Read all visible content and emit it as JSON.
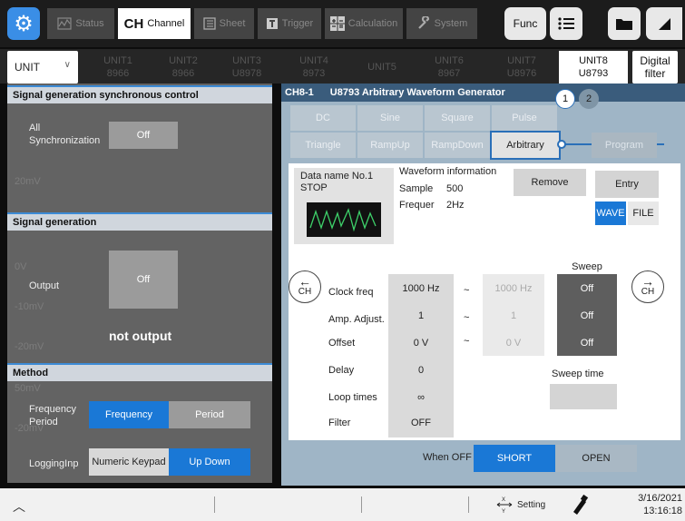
{
  "toolbar": {
    "tabs": [
      {
        "label": "Status",
        "icon": "status-icon"
      },
      {
        "label_big": "CH",
        "label_small": "Channel"
      },
      {
        "label": "Sheet",
        "icon": "sheet-icon"
      },
      {
        "label": "Trigger",
        "icon": "trigger-icon"
      },
      {
        "label": "Calculation",
        "icon": "calculation-icon"
      },
      {
        "label": "System",
        "icon": "wrench-icon"
      }
    ],
    "func_label": "Func"
  },
  "unitbar": {
    "selector": "UNIT",
    "units": [
      {
        "name": "UNIT1",
        "model": "8966"
      },
      {
        "name": "UNIT2",
        "model": "8966"
      },
      {
        "name": "UNIT3",
        "model": "U8978"
      },
      {
        "name": "UNIT4",
        "model": "8973"
      },
      {
        "name": "UNIT5",
        "model": ""
      },
      {
        "name": "UNIT6",
        "model": "8967"
      },
      {
        "name": "UNIT7",
        "model": "U8976"
      },
      {
        "name": "UNIT8",
        "model": "U8793"
      }
    ],
    "digital_filter": [
      "Digital",
      "filter"
    ]
  },
  "left": {
    "sync_title": "Signal generation synchronous control",
    "all_sync_label": [
      "All",
      "Synchronization"
    ],
    "all_sync_value": "Off",
    "gen_title": "Signal generation",
    "output_label": "Output",
    "output_value": "Off",
    "not_output": "not output",
    "method_title": "Method",
    "freq_period_label": [
      "Frequency",
      "Period"
    ],
    "frequency_btn": "Frequency",
    "period_btn": "Period",
    "logging_label": "LoggingInp",
    "numeric_btn": "Numeric Keypad",
    "updown_btn": "Up Down",
    "ghost_text": [
      "20mV",
      "0V",
      "-10mV",
      "-20mV",
      "50mV",
      "-20mV"
    ]
  },
  "dialog": {
    "channel": "CH8-1",
    "title": "U8793 Arbitrary Waveform Generator",
    "pages": [
      "1",
      "2"
    ],
    "wave_buttons_row1": [
      "DC",
      "Sine",
      "Square",
      "Pulse"
    ],
    "wave_buttons_row2": [
      "Triangle",
      "RampUp",
      "RampDown",
      "Arbitrary"
    ],
    "program_btn": "Program",
    "data_name": "Data name",
    "data_no": "No.1",
    "data_state": "STOP",
    "waveform_info": "Waveform information",
    "sample_label": "Sample",
    "sample_value": "500",
    "freq_label": "Frequer",
    "freq_value": "2Hz",
    "remove_btn": "Remove",
    "entry_btn": "Entry",
    "wave_toggle": "WAVE",
    "file_toggle": "FILE",
    "sweep_label": "Sweep",
    "sweep_time_label": "Sweep time",
    "nav_prev": [
      "←",
      "CH"
    ],
    "nav_next": [
      "→",
      "CH"
    ],
    "rows": [
      {
        "label": "Clock freq",
        "value": "1000 Hz",
        "tilde": "~",
        "end": "1000 Hz",
        "sweep": "Off"
      },
      {
        "label": "Amp. Adjust.",
        "value": "1",
        "tilde": "~",
        "end": "1",
        "sweep": "Off"
      },
      {
        "label": "Offset",
        "value": "0 V",
        "tilde": "~",
        "end": "0 V",
        "sweep": "Off"
      },
      {
        "label": "Delay",
        "value": "0"
      },
      {
        "label": "Loop times",
        "value": "∞"
      },
      {
        "label": "Filter",
        "value": "OFF"
      }
    ],
    "when_off_label": "When OFF",
    "short_btn": "SHORT",
    "open_btn": "OPEN"
  },
  "statusbar": {
    "setting_label": "Setting",
    "date": "3/16/2021",
    "time": "13:16:18"
  },
  "colors": {
    "accent": "#1a78d6",
    "header": "#3a5c7c",
    "dark": "#5e5e5e"
  }
}
